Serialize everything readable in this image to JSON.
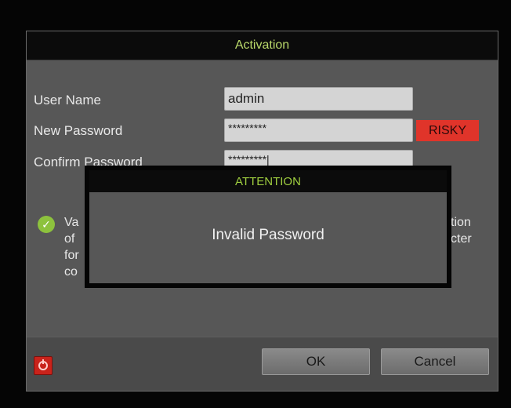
{
  "dialog": {
    "title": "Activation",
    "user_name_label": "User Name",
    "user_name_value": "admin",
    "new_password_label": "New Password",
    "new_password_value": "*********",
    "strength_label": "RISKY",
    "confirm_password_label": "Confirm Password",
    "confirm_password_value": "*********|",
    "note_fragments": [
      "Va",
      "of",
      "for",
      "co",
      "tion",
      "cter"
    ],
    "ok_label": "OK",
    "cancel_label": "Cancel"
  },
  "attention": {
    "title": "ATTENTION",
    "message": "Invalid Password"
  },
  "colors": {
    "title_text": "#b9d86a",
    "risky_bg": "#e0342a",
    "check_bg": "#8dc23d"
  },
  "icons": {
    "check": "check-circle-icon",
    "power": "power-icon"
  }
}
